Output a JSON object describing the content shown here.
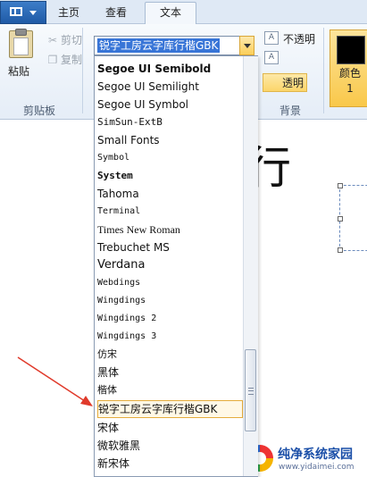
{
  "tabs": {
    "home": "主页",
    "view": "查看",
    "text": "文本"
  },
  "clipboard": {
    "paste_label": "粘贴",
    "cut_label": "剪切",
    "copy_label": "复制",
    "group_label": "剪贴板"
  },
  "font_combo": {
    "value": "锐字工房云字库行楷GBK"
  },
  "font_list": [
    "Segoe UI Semibold",
    "Segoe UI Semilight",
    "Segoe UI Symbol",
    "SimSun-ExtB",
    "Small Fonts",
    "Symbol",
    "System",
    "Tahoma",
    "Terminal",
    "Times New Roman",
    "Trebuchet MS",
    "Verdana",
    "Webdings",
    "Wingdings",
    "Wingdings 2",
    "Wingdings 3",
    "仿宋",
    "黑体",
    "楷体",
    "锐字工房云字库行楷GBK",
    "宋体",
    "微软雅黑",
    "新宋体"
  ],
  "background": {
    "opaque_label": "不透明",
    "transparent_label": "透明",
    "group_label": "背景"
  },
  "color": {
    "label": "颜色 1",
    "swatch": "#000000"
  },
  "canvas": {
    "sample_char": "行"
  },
  "watermark": {
    "title": "纯净系统家园",
    "url": "www.yidaimei.com"
  }
}
